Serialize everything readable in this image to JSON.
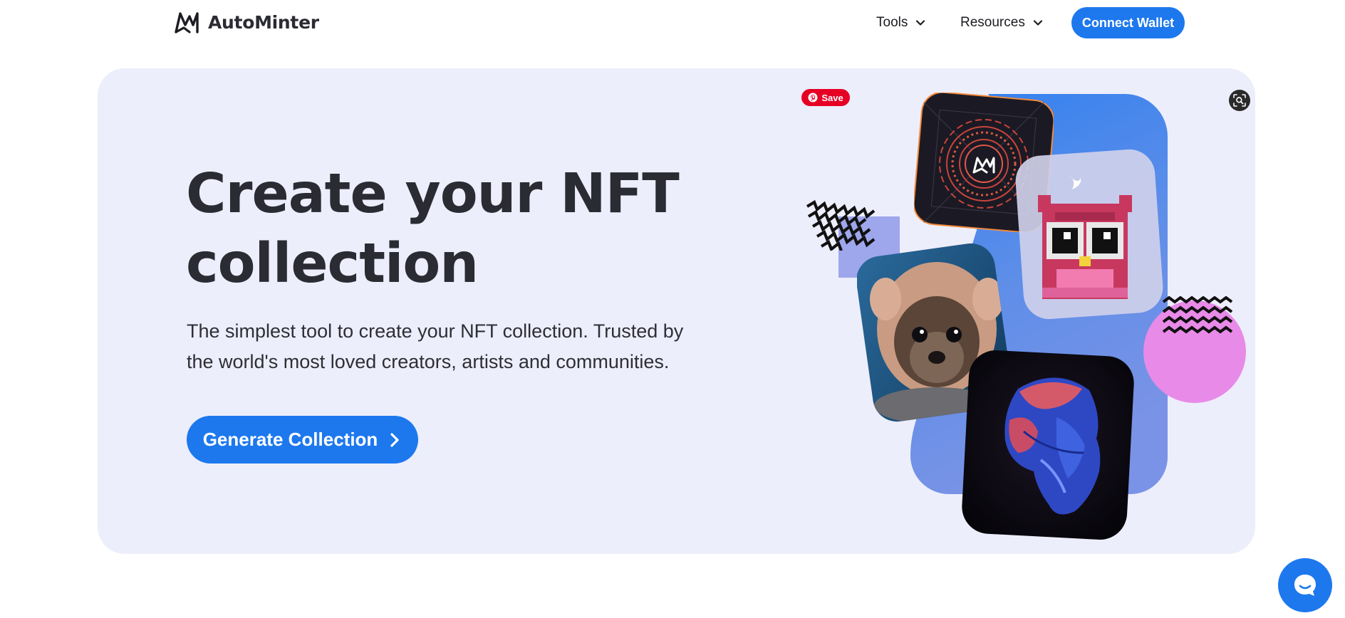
{
  "header": {
    "brand_name": "AutoMinter",
    "nav": [
      {
        "label": "Tools"
      },
      {
        "label": "Resources"
      }
    ],
    "connect_label": "Connect Wallet"
  },
  "hero": {
    "title_line1": "Create your NFT",
    "title_line2": "collection",
    "subtitle_line1": "The simplest tool to create your NFT collection. Trusted by",
    "subtitle_line2": "the world's most loved creators, artists and communities.",
    "cta_label": "Generate Collection",
    "pin_save_label": "Save"
  },
  "colors": {
    "accent": "#1d78ee",
    "hero_bg": "#edeefb",
    "text_dark": "#2b2b33",
    "pinterest": "#e60023"
  },
  "icons": [
    "autominter-logo-icon",
    "chevron-down-icon",
    "chevron-right-icon",
    "pinterest-icon",
    "visual-search-icon",
    "chat-bubble-icon"
  ]
}
